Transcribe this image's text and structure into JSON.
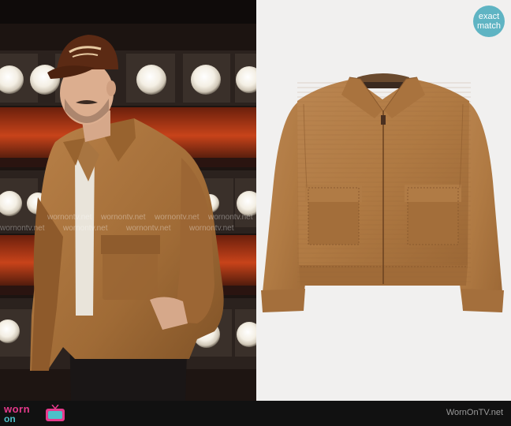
{
  "badge": {
    "line1": "exact",
    "line2": "match",
    "color": "#5fb4c3"
  },
  "footer": {
    "logo_worn": "worn",
    "logo_on": "on",
    "logo_tv": "tv",
    "site_name": "WornOnTV.net"
  },
  "colors": {
    "jacket_suede": "#b07a43",
    "background_right": "#f1f0ef",
    "footer": "#111111",
    "logo_pink": "#e63a8c",
    "logo_teal": "#4ec0c9"
  },
  "icons": {
    "tv": "tv-icon"
  }
}
